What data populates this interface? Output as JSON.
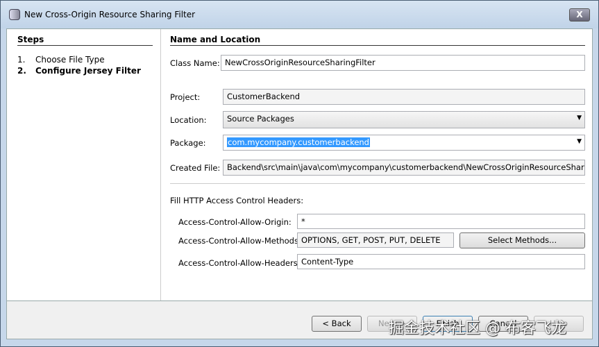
{
  "window": {
    "title": "New Cross-Origin Resource Sharing Filter",
    "close_label": "X"
  },
  "steps": {
    "heading": "Steps",
    "items": [
      {
        "num": "1.",
        "label": "Choose File Type"
      },
      {
        "num": "2.",
        "label": "Configure Jersey Filter"
      }
    ]
  },
  "form": {
    "heading": "Name and Location",
    "class_name_label": "Class Name:",
    "class_name": "NewCrossOriginResourceSharingFilter",
    "project_label": "Project:",
    "project": "CustomerBackend",
    "location_label": "Location:",
    "location": "Source Packages",
    "package_label": "Package:",
    "package": "com.mycompany.customerbackend",
    "created_file_label": "Created File:",
    "created_file": "Backend\\src\\main\\java\\com\\mycompany\\customerbackend\\NewCrossOriginResourceSharingFilte",
    "headers_heading": "Fill HTTP Access Control Headers:",
    "origin_label": "Access-Control-Allow-Origin:",
    "origin": "*",
    "methods_label": "Access-Control-Allow-Methods:",
    "methods": "OPTIONS, GET, POST, PUT, DELETE",
    "select_methods": "Select Methods...",
    "headers_label": "Access-Control-Allow-Headers:",
    "headers": "Content-Type"
  },
  "buttons": {
    "back": "< Back",
    "next": "Next >",
    "finish": "Finish",
    "cancel": "Cancel",
    "help": "Help"
  },
  "watermark": "掘金技术社区 @ 布客飞龙"
}
